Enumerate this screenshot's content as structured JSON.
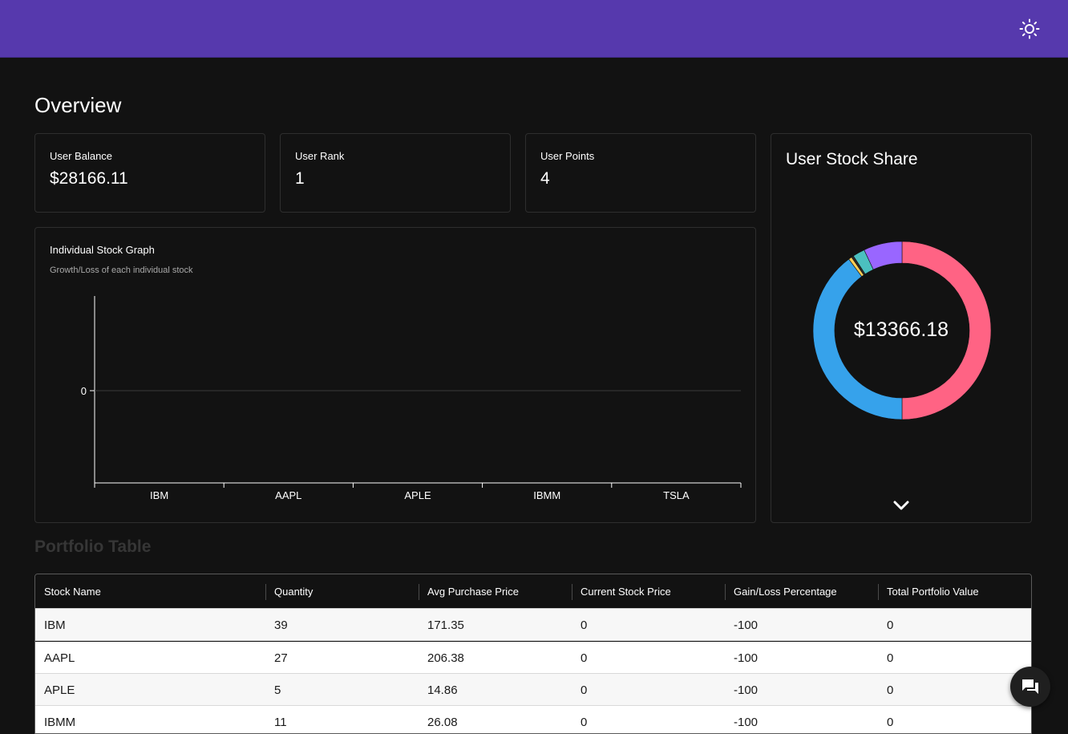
{
  "header": {
    "theme_toggle_icon": "sun-icon",
    "bar_color": "#5639ad"
  },
  "overview": {
    "title": "Overview",
    "stats": [
      {
        "label": "User Balance",
        "value": "$28166.11"
      },
      {
        "label": "User Rank",
        "value": "1"
      },
      {
        "label": "User Points",
        "value": "4"
      }
    ]
  },
  "stock_graph": {
    "title": "Individual Stock Graph",
    "subtitle": "Growth/Loss of each individual stock"
  },
  "stock_share": {
    "title": "User Stock Share",
    "center_value": "$13366.18",
    "expand_icon": "chevron-down-icon"
  },
  "portfolio": {
    "title": "Portfolio Table",
    "columns": [
      "Stock Name",
      "Quantity",
      "Avg Purchase Price",
      "Current Stock Price",
      "Gain/Loss Percentage",
      "Total Portfolio Value"
    ],
    "rows": [
      [
        "IBM",
        "39",
        "171.35",
        "0",
        "-100",
        "0"
      ],
      [
        "AAPL",
        "27",
        "206.38",
        "0",
        "-100",
        "0"
      ],
      [
        "APLE",
        "5",
        "14.86",
        "0",
        "-100",
        "0"
      ],
      [
        "IBMM",
        "11",
        "26.08",
        "0",
        "-100",
        "0"
      ]
    ]
  },
  "chat": {
    "icon": "chat-icon"
  },
  "chart_data": [
    {
      "type": "bar",
      "title": "Individual Stock Graph",
      "subtitle": "Growth/Loss of each individual stock",
      "categories": [
        "IBM",
        "AAPL",
        "APLE",
        "IBMM",
        "TSLA"
      ],
      "values": [
        0,
        0,
        0,
        0,
        0
      ],
      "yticks": [
        "0"
      ],
      "grid": true
    },
    {
      "type": "pie",
      "variant": "donut",
      "title": "User Stock Share",
      "center_label": "$13366.18",
      "slices": [
        {
          "value": 50.0,
          "color": "#ff6384"
        },
        {
          "value": 39.8,
          "color": "#36a2eb"
        },
        {
          "value": 0.6,
          "color": "#ffce56"
        },
        {
          "value": 0.4,
          "color": "#2a2a2a"
        },
        {
          "value": 2.2,
          "color": "#4bc0c0"
        },
        {
          "value": 7.0,
          "color": "#9966ff"
        }
      ]
    }
  ]
}
